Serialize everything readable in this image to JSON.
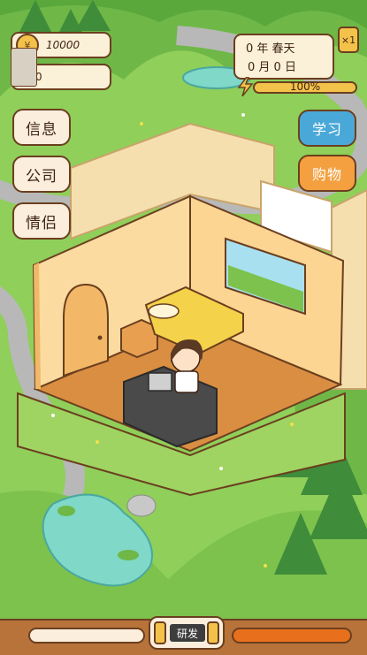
{
  "hud": {
    "money": "10000",
    "second_value": "0",
    "date_line1": "0 年 春天",
    "date_line2": "0 月 0 日",
    "speed": "×1",
    "energy_pct_text": "100%",
    "energy_value": 1.0
  },
  "menu_left": {
    "info": "信息",
    "company": "公司",
    "partner": "情侣"
  },
  "menu_right": {
    "study": "学习",
    "shop": "购物"
  },
  "bottom": {
    "develop_label": "研发"
  },
  "colors": {
    "outline": "#6b3f1f",
    "panel": "#fbf0d8",
    "study_button": "#4aa8d8",
    "shop_button": "#f4a040",
    "energy_fill": "#f3c24a",
    "progress_fill": "#e8701c",
    "grass": "#8fcf5a",
    "road": "#b8b8b8"
  },
  "icons": {
    "money": "coin-bag-icon",
    "energy": "lightning-bolt-icon",
    "develop": "game-console-icon"
  }
}
